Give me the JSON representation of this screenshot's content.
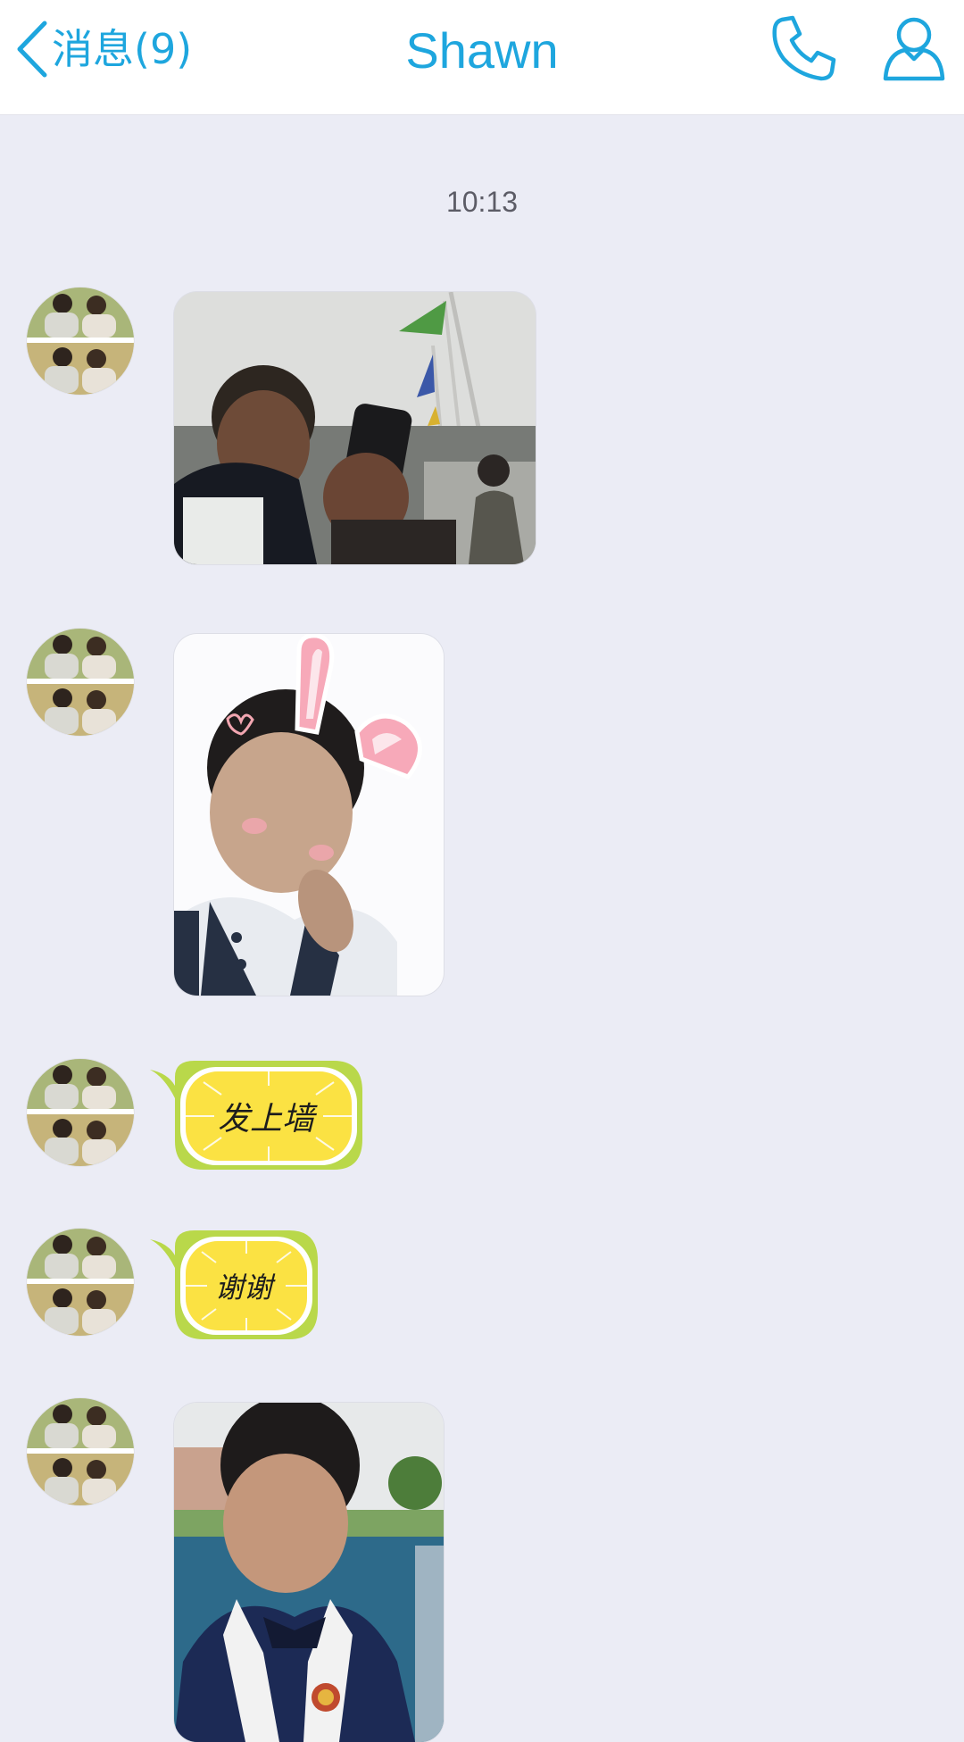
{
  "header": {
    "back_label": "消息(9)",
    "title": "Shawn"
  },
  "colors": {
    "accent": "#1ea6de",
    "background": "#ebecf5",
    "sticker_green": "#b9d84a",
    "sticker_yellow": "#fbe243"
  },
  "icons": {
    "back": "chevron-left-icon",
    "call": "phone-icon",
    "profile": "person-icon"
  },
  "chat": {
    "timestamp": "10:13",
    "messages": [
      {
        "type": "image",
        "content": "photo"
      },
      {
        "type": "image",
        "content": "photo"
      },
      {
        "type": "sticker",
        "text": "发上墙"
      },
      {
        "type": "sticker",
        "text": "谢谢"
      },
      {
        "type": "image",
        "content": "photo"
      }
    ]
  }
}
